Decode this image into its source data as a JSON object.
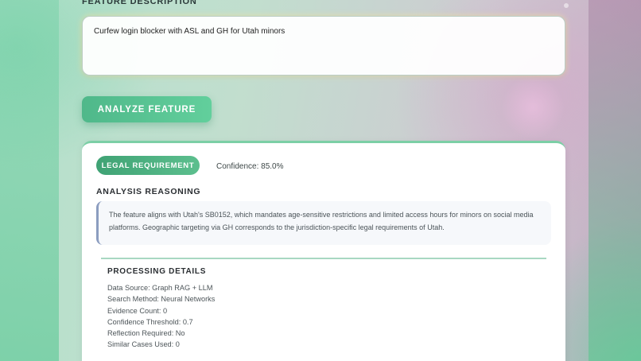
{
  "feature": {
    "section_label": "FEATURE DESCRIPTION",
    "input_value": "Curfew login blocker with ASL and GH for Utah minors"
  },
  "analyze_button": {
    "label": "ANALYZE FEATURE"
  },
  "result": {
    "badge": "LEGAL REQUIREMENT",
    "confidence_text": "Confidence: 85.0%",
    "reasoning_title": "ANALYSIS REASONING",
    "reasoning_text": "The feature aligns with Utah's SB0152, which mandates age-sensitive restrictions and limited access hours for minors on social media platforms. Geographic targeting via GH corresponds to the jurisdiction-specific legal requirements of Utah.",
    "processing": {
      "title": "PROCESSING DETAILS",
      "lines": [
        "Data Source: Graph RAG + LLM",
        "Search Method: Neural Networks",
        "Evidence Count: 0",
        "Confidence Threshold: 0.7",
        "Reflection Required: No",
        "Similar Cases Used: 0"
      ]
    }
  },
  "colors": {
    "accent": "#4fb88a",
    "badge": "#3fa274",
    "reasoning_border": "#8c9dc0"
  }
}
